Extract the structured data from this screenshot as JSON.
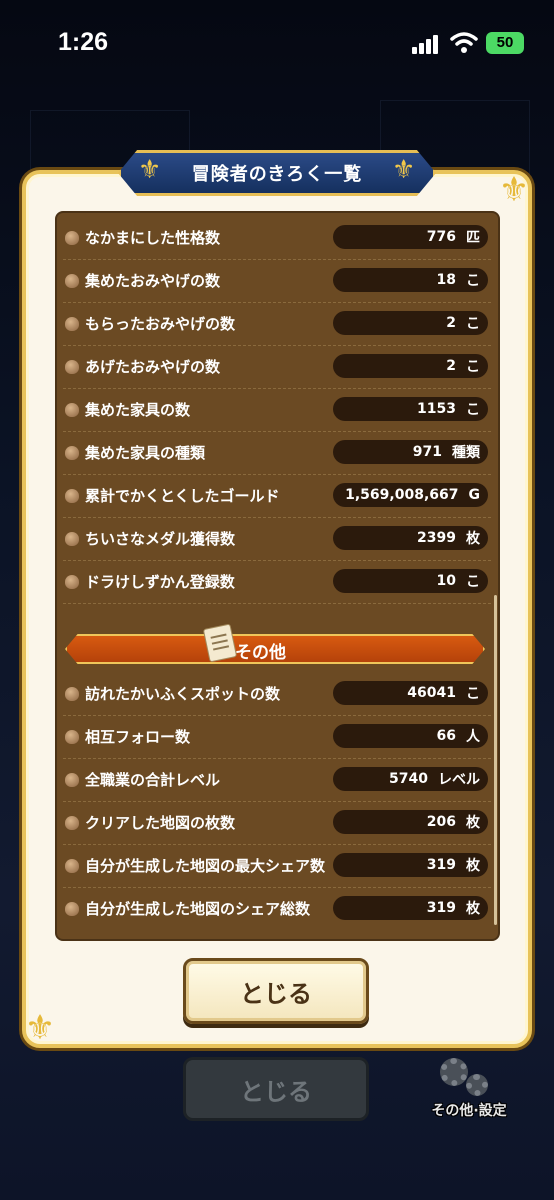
{
  "status_bar": {
    "time": "1:26",
    "battery": "50"
  },
  "modal": {
    "title": "冒険者のきろく一覧",
    "section_header": "その他",
    "close_label": "とじる"
  },
  "records": [
    {
      "label": "なかまにした性格数",
      "value": "776",
      "unit": "匹"
    },
    {
      "label": "集めたおみやげの数",
      "value": "18",
      "unit": "こ"
    },
    {
      "label": "もらったおみやげの数",
      "value": "2",
      "unit": "こ"
    },
    {
      "label": "あげたおみやげの数",
      "value": "2",
      "unit": "こ"
    },
    {
      "label": "集めた家具の数",
      "value": "1153",
      "unit": "こ"
    },
    {
      "label": "集めた家具の種類",
      "value": "971",
      "unit": "種類"
    },
    {
      "label": "累計でかくとくしたゴールド",
      "value": "1,569,008,667",
      "unit": "G"
    },
    {
      "label": "ちいさなメダル獲得数",
      "value": "2399",
      "unit": "枚"
    },
    {
      "label": "ドラけしずかん登録数",
      "value": "10",
      "unit": "こ"
    }
  ],
  "other_records": [
    {
      "label": "訪れたかいふくスポットの数",
      "value": "46041",
      "unit": "こ"
    },
    {
      "label": "相互フォロー数",
      "value": "66",
      "unit": "人"
    },
    {
      "label": "全職業の合計レベル",
      "value": "5740",
      "unit": "レベル"
    },
    {
      "label": "クリアした地図の枚数",
      "value": "206",
      "unit": "枚"
    },
    {
      "label": "自分が生成した地図の最大シェア数",
      "value": "319",
      "unit": "枚"
    },
    {
      "label": "自分が生成した地図のシェア総数",
      "value": "319",
      "unit": "枚"
    }
  ],
  "background": {
    "close_label": "とじる",
    "settings_label": "その他·設定"
  },
  "colors": {
    "panel_brown": "#6b4a23",
    "value_box": "#2b1a0c",
    "section_orange": "#c94d0c",
    "frame_gold": "#e8c35a",
    "title_blue": "#1f3d74"
  }
}
